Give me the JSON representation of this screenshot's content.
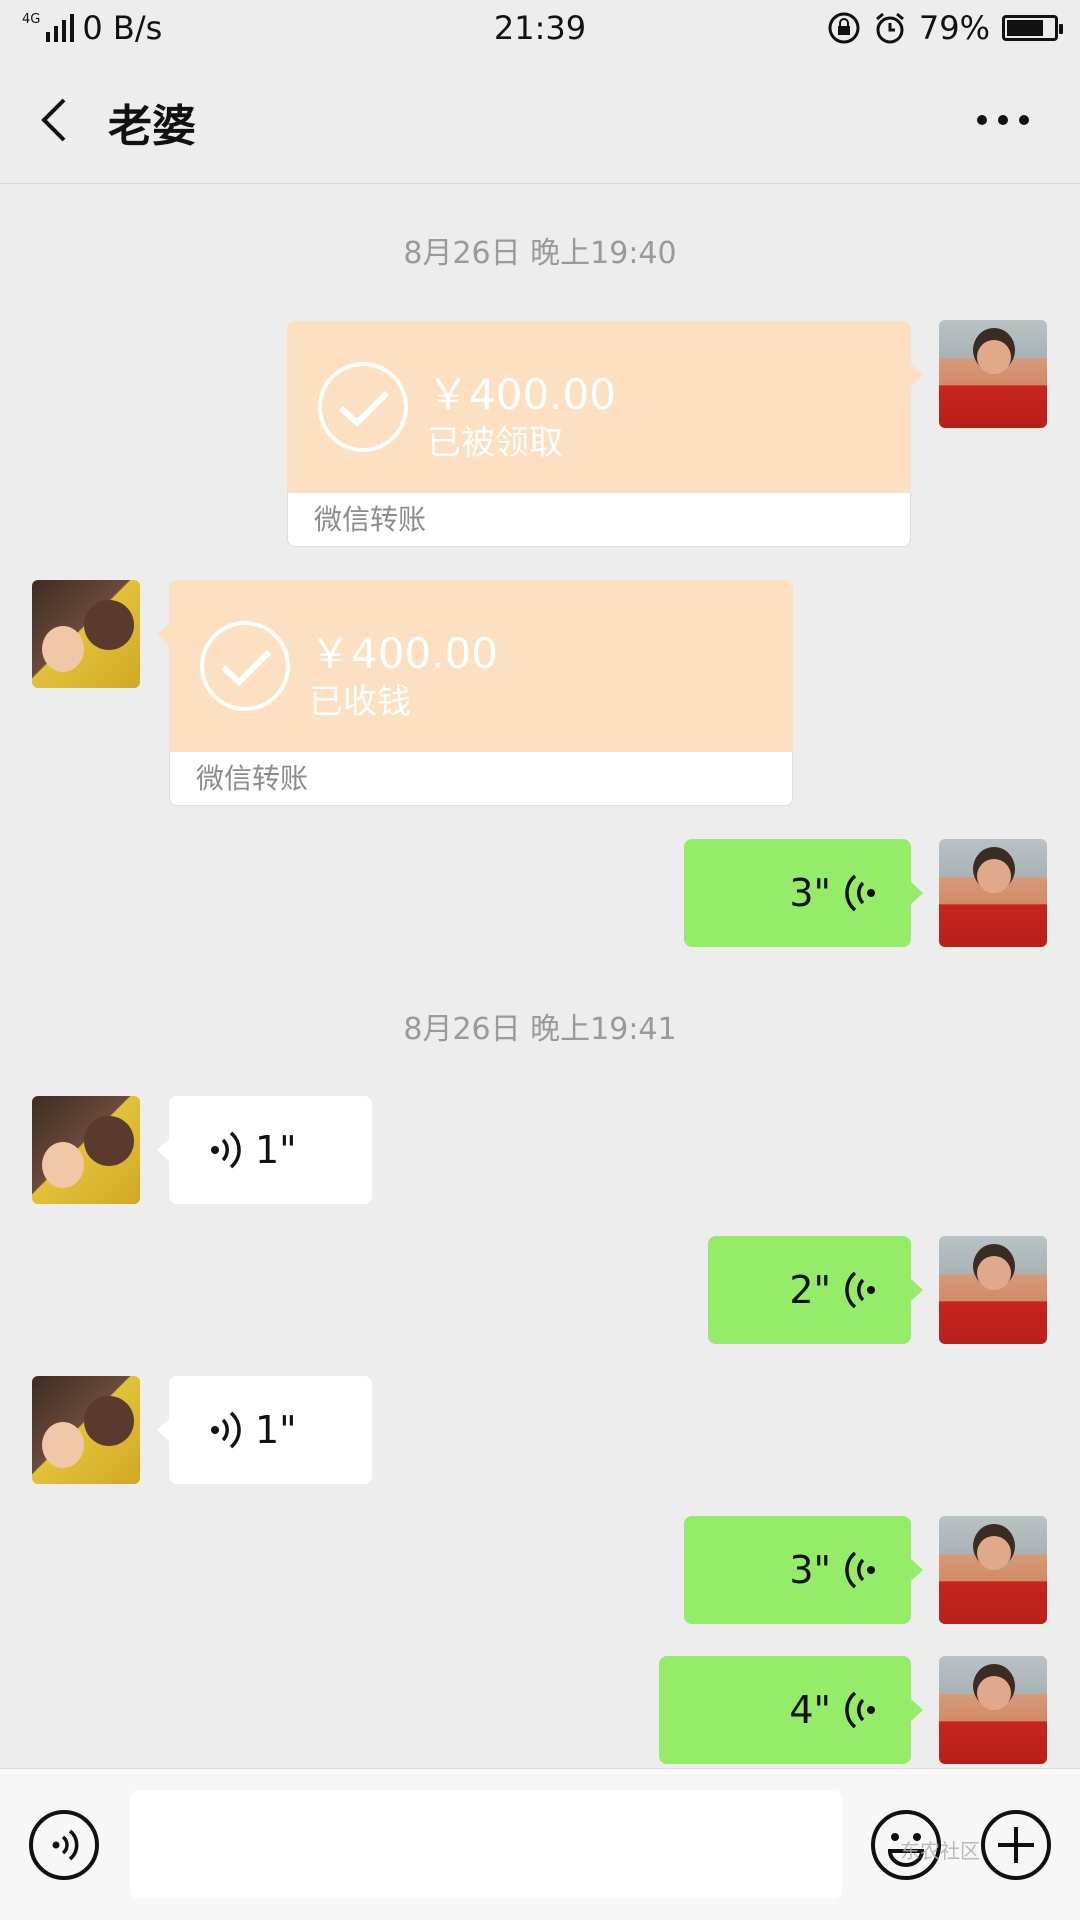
{
  "status_bar": {
    "network_type": "4G",
    "speed": "0 B/s",
    "time": "21:39",
    "battery_percent": "79%",
    "battery_level": 0.79
  },
  "nav": {
    "title": "老婆"
  },
  "chat": {
    "timestamps": [
      "8月26日 晚上19:40",
      "8月26日 晚上19:41"
    ],
    "transfer_sent": {
      "amount": "￥400.00",
      "status": "已被领取",
      "footer": "微信转账"
    },
    "transfer_received": {
      "amount": "￥400.00",
      "status": "已收钱",
      "footer": "微信转账"
    },
    "voice_messages": [
      {
        "direction": "sent",
        "duration": "3\""
      },
      {
        "direction": "received",
        "duration": "1\""
      },
      {
        "direction": "sent",
        "duration": "2\""
      },
      {
        "direction": "received",
        "duration": "1\""
      },
      {
        "direction": "sent",
        "duration": "3\""
      },
      {
        "direction": "sent",
        "duration": "4\""
      }
    ]
  },
  "input_bar": {
    "watermark": "东农社区"
  },
  "colors": {
    "sent_bubble": "#95ec69",
    "received_bubble": "#ffffff",
    "transfer_bubble": "#fce0c1",
    "background": "#ededed"
  },
  "icons": [
    "back-arrow-icon",
    "more-icon",
    "voice-mode-icon",
    "emoji-icon",
    "plus-icon",
    "check-circle-icon",
    "voice-wave-icon",
    "lock-rotation-icon",
    "alarm-icon",
    "battery-icon",
    "signal-icon"
  ]
}
